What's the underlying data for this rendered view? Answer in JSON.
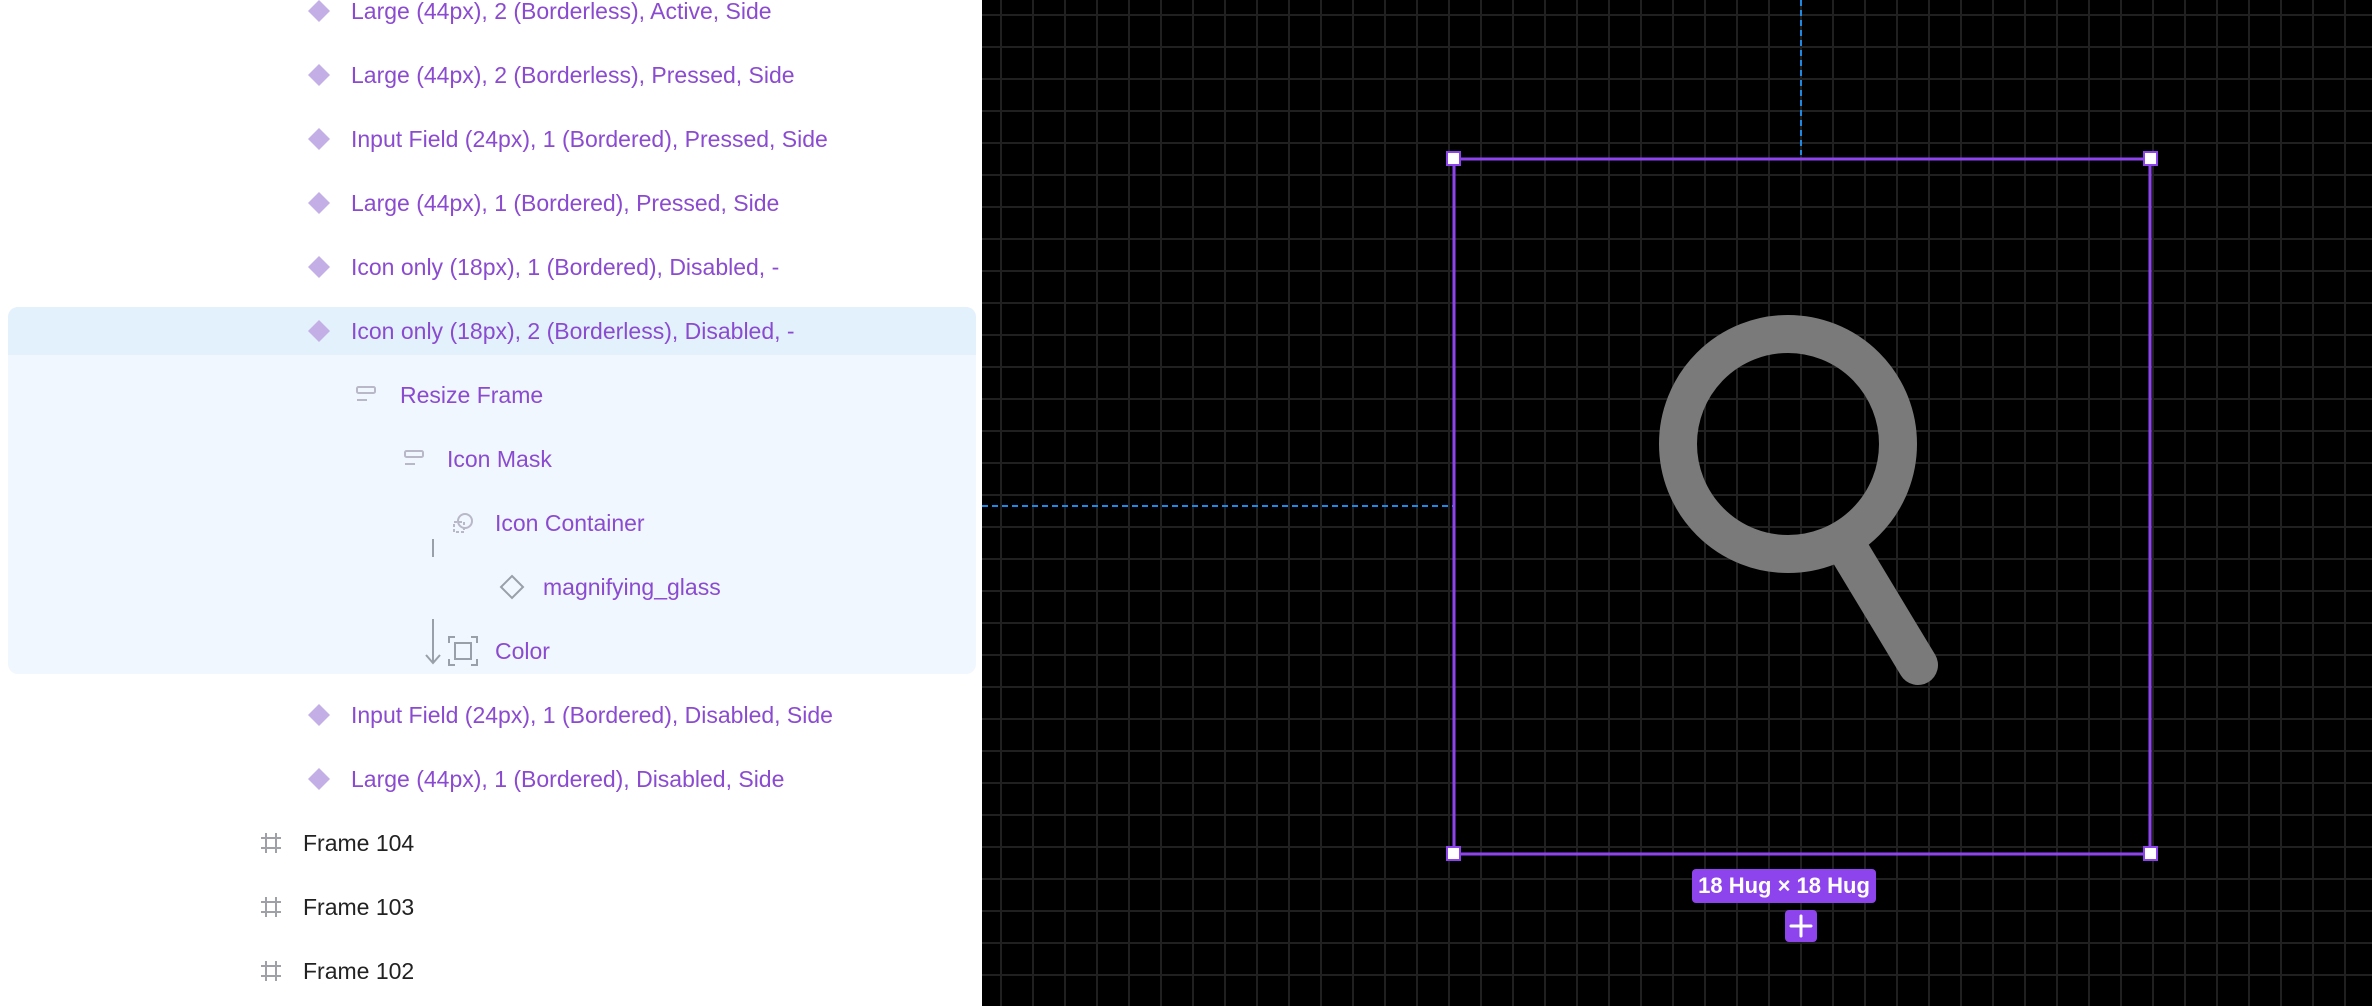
{
  "layers": {
    "items": [
      {
        "label": "Large (44px), 2 (Borderless), Active, Side",
        "type": "component-instance-icon"
      },
      {
        "label": "Large (44px), 2 (Borderless), Pressed, Side",
        "type": "component-instance-icon"
      },
      {
        "label": "Input Field (24px), 1 (Bordered), Pressed, Side",
        "type": "component-instance-icon"
      },
      {
        "label": "Large (44px), 1 (Bordered), Pressed, Side",
        "type": "component-instance-icon"
      },
      {
        "label": "Icon only (18px), 1 (Bordered), Disabled, -",
        "type": "component-instance-icon"
      },
      {
        "label": "Icon only (18px), 2 (Borderless), Disabled, -",
        "type": "component-instance-icon",
        "selected": true
      },
      {
        "label": "Resize Frame",
        "type": "auto-layout-icon"
      },
      {
        "label": "Icon Mask",
        "type": "auto-layout-icon"
      },
      {
        "label": "Icon Container",
        "type": "boolean-union-icon"
      },
      {
        "label": "magnifying_glass",
        "type": "component-outline-icon"
      },
      {
        "label": "Color",
        "type": "frame-bounds-icon"
      },
      {
        "label": "Input Field (24px), 1 (Bordered), Disabled, Side",
        "type": "component-instance-icon"
      },
      {
        "label": "Large (44px), 1 (Bordered), Disabled, Side",
        "type": "component-instance-icon"
      },
      {
        "label": "Frame 104",
        "type": "frame-hash-icon"
      },
      {
        "label": "Frame 103",
        "type": "frame-hash-icon"
      },
      {
        "label": "Frame 102",
        "type": "frame-hash-icon"
      }
    ]
  },
  "canvas": {
    "size_label": "18 Hug × 18 Hug",
    "add_icon": "plus-icon",
    "content_icon": "magnifying-glass-icon"
  },
  "colors": {
    "selection": "#8e44ec",
    "layer_text": "#8b4bd0",
    "guide": "#1e88e5",
    "icon_fill": "#7a7a7a",
    "selected_row": "#e3f1fd",
    "selected_block": "#f0f7fe"
  }
}
